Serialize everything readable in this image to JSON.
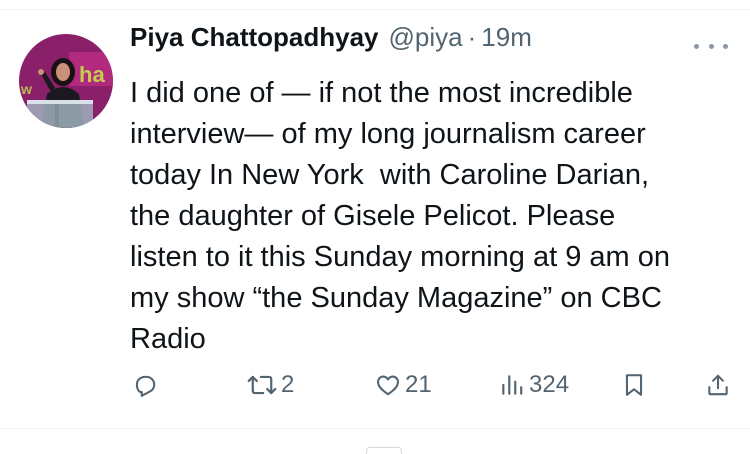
{
  "tweet": {
    "display_name": "Piya Chattopadhyay",
    "handle": "@piya",
    "separator": "·",
    "time": "19m",
    "text_lines": [
      "I did one of — if not the most incredible",
      "interview— of my long journalism career",
      "today In New York  with Caroline Darian,",
      "the daughter of Gisele Pelicot. Please",
      "listen to it this Sunday morning at 9 am on",
      "my show “the Sunday Magazine” on CBC",
      "Radio"
    ]
  },
  "actions": {
    "reply": {
      "icon": "reply-icon",
      "count": ""
    },
    "repost": {
      "icon": "repost-icon",
      "count": "2"
    },
    "like": {
      "icon": "heart-icon",
      "count": "21"
    },
    "views": {
      "icon": "views-icon",
      "count": "324"
    },
    "bookmark": {
      "icon": "bookmark-icon",
      "count": ""
    },
    "share": {
      "icon": "share-icon",
      "count": ""
    }
  },
  "colors": {
    "text": "#0f1419",
    "secondary": "#536471",
    "divider": "#eff3f4",
    "avatar_bg": "#8a1f6a"
  }
}
